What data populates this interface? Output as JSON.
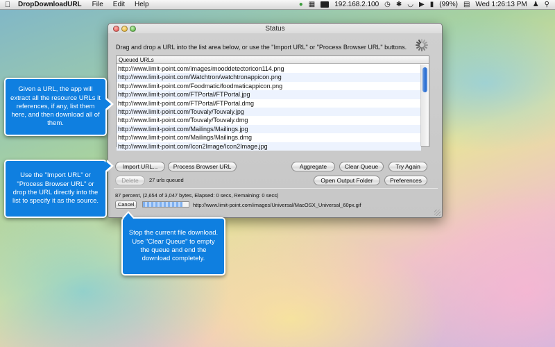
{
  "menubar": {
    "apple_icon": "apple-icon",
    "app_name": "DropDownloadURL",
    "menus": [
      "File",
      "Edit",
      "Help"
    ],
    "ip": "192.168.2.100",
    "battery": "(99%)",
    "clock": "Wed 1:26:13 PM"
  },
  "window": {
    "title": "Status",
    "instructions": "Drag and drop a URL into the list area below, or use the \"Import URL\" or \"Process Browser URL\" buttons.",
    "list_header": "Queued URLs",
    "urls": [
      "http://www.limit-point.com/images/mooddetectoricon114.png",
      "http://www.limit-point.com/Watchtron/watchtronappicon.png",
      "http://www.limit-point.com/Foodmatic/foodmaticappicon.png",
      "http://www.limit-point.com/FTPortal/FTPortal.jpg",
      "http://www.limit-point.com/FTPortal/FTPortal.dmg",
      "http://www.limit-point.com/Touvaly/Touvaly.jpg",
      "http://www.limit-point.com/Touvaly/Touvaly.dmg",
      "http://www.limit-point.com/Mailings/Mailings.jpg",
      "http://www.limit-point.com/Mailings/Mailings.dmg",
      "http://www.limit-point.com/Icon2Image/Icon2Image.jpg"
    ],
    "buttons": {
      "import_url": "Import URL...",
      "process_browser_url": "Process Browser URL",
      "aggregate": "Aggregate",
      "clear_queue": "Clear Queue",
      "try_again": "Try Again",
      "delete": "Delete",
      "open_output_folder": "Open Output Folder",
      "preferences": "Preferences",
      "cancel": "Cancel"
    },
    "queue_count": "27 urls queued",
    "status_line": "87 percent, (2,654 of 3,047 bytes, Elapsed: 0 secs, Remaining: 0 secs)",
    "progress_fraction": 0.87,
    "current_url": "http://www.limit-point.com/images/Universal/MacOSX_Universal_60px.gif"
  },
  "callouts": {
    "given_url": "Given a URL, the app will extract all the resource URLs it references, if any, list them here, and then download all of them.",
    "import_help": "Use the \"Import URL\" or \"Process Browser URL\" or drop the URL directly into the list to specify it as the source.",
    "cancel_help": "Stop the current file download. Use \"Clear Queue\" to empty the queue and end the download completely."
  },
  "colors": {
    "callout_blue": "#0f7fe0",
    "scroll_thumb": "#2a6fd3"
  }
}
